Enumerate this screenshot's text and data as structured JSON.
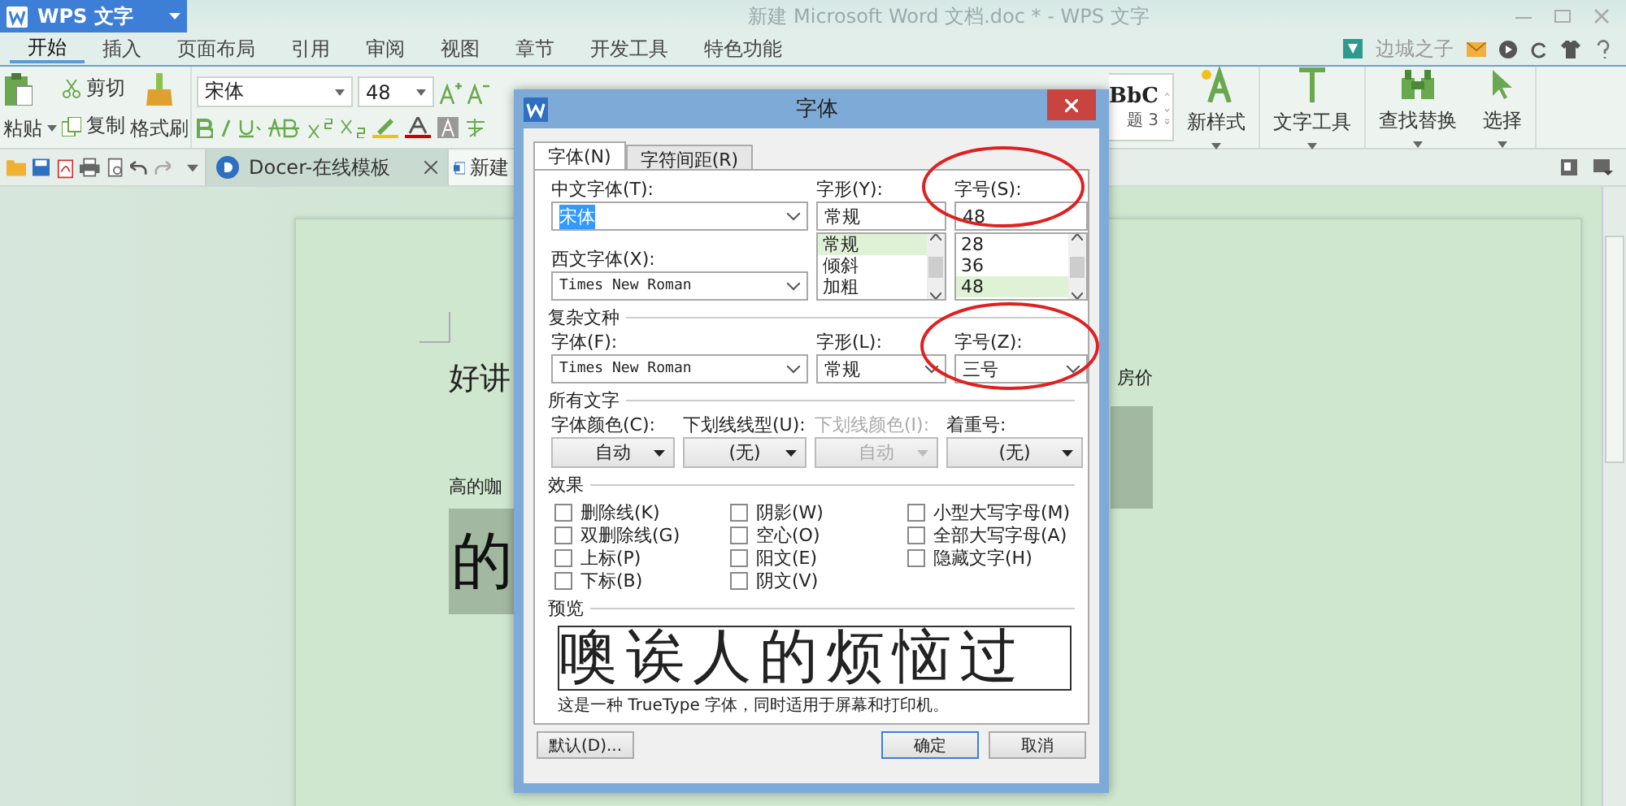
{
  "app_menu": {
    "label": "WPS 文字"
  },
  "window": {
    "title": "新建 Microsoft Word 文档.doc * - WPS 文字"
  },
  "menu_tabs": [
    {
      "label": "开始",
      "selected": true
    },
    {
      "label": "插入",
      "selected": false
    },
    {
      "label": "页面布局",
      "selected": false
    },
    {
      "label": "引用",
      "selected": false
    },
    {
      "label": "审阅",
      "selected": false
    },
    {
      "label": "视图",
      "selected": false
    },
    {
      "label": "章节",
      "selected": false
    },
    {
      "label": "开发工具",
      "selected": false
    },
    {
      "label": "特色功能",
      "selected": false
    }
  ],
  "user": {
    "name": "边城之子"
  },
  "ribbon": {
    "paste": "粘贴",
    "cut": "剪切",
    "copy": "复制",
    "format_painter": "格式刷",
    "font_name": "宋体",
    "font_size": "48",
    "style_preview": "BbC",
    "style_caption": "题 3",
    "big_buttons": [
      {
        "label": "新样式",
        "kind": "newstyle"
      },
      {
        "label": "文字工具",
        "kind": "text"
      },
      {
        "label": "查找替换",
        "kind": "find"
      },
      {
        "label": "选择",
        "kind": "select"
      }
    ]
  },
  "doc_tabs": [
    {
      "label": "Docer-在线模板",
      "selected": false
    },
    {
      "label": "新建",
      "selected": true
    }
  ],
  "document": {
    "rows": [
      {
        "left": {
          "text": "好讲",
          "kind": "normal",
          "selected": false
        },
        "right": {
          "text": "房价",
          "kind": "small",
          "selected": false
        }
      },
      {
        "left": {
          "text": "高的咖",
          "kind": "small",
          "selected": false
        },
        "right": {
          "kind": "highlight",
          "selected": true
        }
      },
      {
        "left": {
          "text": "的",
          "kind": "large",
          "selected": true
        }
      }
    ]
  },
  "dialog": {
    "title": "字体",
    "tabs": [
      {
        "label": "字体(N)",
        "selected": true
      },
      {
        "label": "字符间距(R)",
        "selected": false
      }
    ],
    "chinese_font": {
      "label": "中文字体(T):",
      "value": "宋体"
    },
    "font_style": {
      "label": "字形(Y):",
      "value": "常规",
      "options": [
        {
          "label": "常规",
          "selected": true
        },
        {
          "label": "倾斜",
          "selected": false
        },
        {
          "label": "加粗",
          "selected": false
        }
      ]
    },
    "font_size": {
      "label": "字号(S):",
      "value": "48",
      "options": [
        {
          "label": "28",
          "selected": false
        },
        {
          "label": "36",
          "selected": false
        },
        {
          "label": "48",
          "selected": true
        }
      ]
    },
    "western_font": {
      "label": "西文字体(X):",
      "value": "Times New Roman"
    },
    "complex_section": "复杂文种",
    "complex_font": {
      "label": "字体(F):",
      "value": "Times New Roman"
    },
    "complex_style": {
      "label": "字形(L):",
      "value": "常规"
    },
    "complex_size": {
      "label": "字号(Z):",
      "value": "三号"
    },
    "all_text_section": "所有文字",
    "all_text": [
      {
        "label": "字体颜色(C):",
        "value": "自动",
        "disabled": false
      },
      {
        "label": "下划线线型(U):",
        "value": "(无)",
        "disabled": false
      },
      {
        "label": "下划线颜色(I):",
        "value": "自动",
        "disabled": true
      },
      {
        "label": "着重号:",
        "value": "(无)",
        "disabled": false
      }
    ],
    "effects_section": "效果",
    "effects": [
      {
        "label": "删除线(K)",
        "checked": false
      },
      {
        "label": "双删除线(G)",
        "checked": false
      },
      {
        "label": "上标(P)",
        "checked": false
      },
      {
        "label": "下标(B)",
        "checked": false
      },
      {
        "label": "阴影(W)",
        "checked": false
      },
      {
        "label": "空心(O)",
        "checked": false
      },
      {
        "label": "阳文(E)",
        "checked": false
      },
      {
        "label": "阴文(V)",
        "checked": false
      },
      {
        "label": "小型大写字母(M)",
        "checked": false
      },
      {
        "label": "全部大写字母(A)",
        "checked": false
      },
      {
        "label": "隐藏文字(H)",
        "checked": false
      }
    ],
    "preview_section": "预览",
    "preview_text": "噢诶人的烦恼过",
    "preview_note": "这是一种 TrueType 字体，同时适用于屏幕和打印机。",
    "buttons": [
      {
        "label": "默认(D)...",
        "kind": "default"
      },
      {
        "label": "确定",
        "kind": "ok"
      },
      {
        "label": "取消",
        "kind": "cancel"
      }
    ]
  }
}
